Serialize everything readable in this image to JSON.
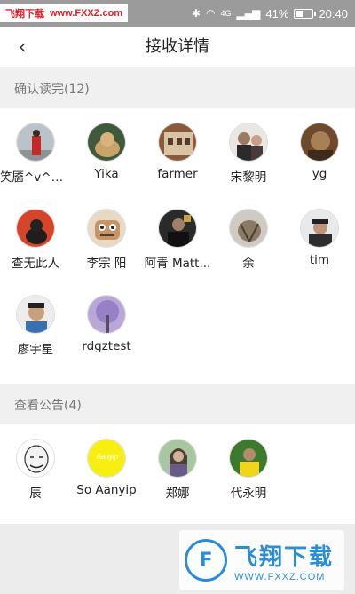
{
  "status": {
    "watermark_cn": "飞翔下载",
    "watermark_url": "www.FXXZ.com",
    "network": "4G",
    "battery": "41%",
    "battery_level": 0.41,
    "time": "20:40"
  },
  "header": {
    "title": "接收详情"
  },
  "read_section": {
    "label": "确认读完(12)",
    "users": [
      {
        "name": "笑靥^v^小...",
        "avatar": "user-photo-red-coat"
      },
      {
        "name": "Yika",
        "avatar": "user-photo-dog"
      },
      {
        "name": "farmer",
        "avatar": "user-photo-building"
      },
      {
        "name": "宋黎明",
        "avatar": "user-photo-couple"
      },
      {
        "name": "yg",
        "avatar": "user-photo-brown"
      },
      {
        "name": "查无此人",
        "avatar": "user-photo-cat"
      },
      {
        "name": "李宗 阳",
        "avatar": "user-photo-cartoon"
      },
      {
        "name": "阿青 Matt...",
        "avatar": "user-photo-man-dark"
      },
      {
        "name": "余",
        "avatar": "user-photo-cat-tabby"
      },
      {
        "name": "tim",
        "avatar": "user-photo-man-cap"
      },
      {
        "name": "廖宇星",
        "avatar": "user-photo-boy"
      },
      {
        "name": "rdgztest",
        "avatar": "user-photo-purple-tree"
      }
    ]
  },
  "viewed_section": {
    "label": "查看公告(4)",
    "users": [
      {
        "name": "辰",
        "avatar": "user-photo-meme"
      },
      {
        "name": "So Aanyip",
        "avatar": "user-photo-yellow",
        "badge": "Aanyip"
      },
      {
        "name": "郑娜",
        "avatar": "user-photo-girl"
      },
      {
        "name": "代永明",
        "avatar": "user-photo-soccer"
      }
    ]
  },
  "footer_watermark": {
    "big": "飞翔下载",
    "small": "WWW.FXXZ.COM"
  }
}
